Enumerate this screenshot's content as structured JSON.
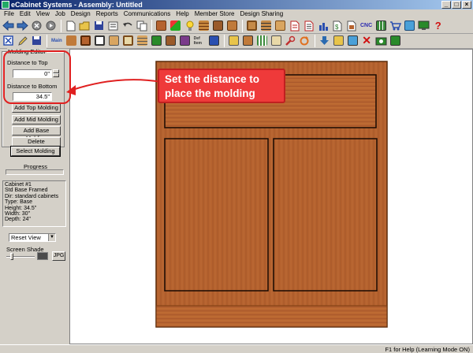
{
  "window": {
    "title": "eCabinet Systems - Assembly: Untitled"
  },
  "menu": [
    "File",
    "Edit",
    "View",
    "Job",
    "Design",
    "Reports",
    "Communications",
    "Help",
    "Member Store",
    "Design Sharing"
  ],
  "toolbar": {
    "cnc_label": "CNC",
    "main_label": "Main",
    "def_label": "Def Item"
  },
  "molding_editor": {
    "group_title": "Molding Editor",
    "distance_top_label": "Distance to Top",
    "distance_top_value": "0\"",
    "distance_bottom_label": "Distance to Bottom",
    "distance_bottom_value": "34.5\"",
    "buttons": [
      "Add Top Molding",
      "Add Mid Molding",
      "Add Base Molding",
      "Delete",
      "Select Molding"
    ]
  },
  "progress": {
    "label": "Progress",
    "value": 0
  },
  "cabinet_info": [
    "Cabinet #1",
    "Std Base Framed",
    "Dir: standard cabinets",
    "Type: Base",
    "Height: 34.5\"",
    "Width: 30\"",
    "Depth: 24\""
  ],
  "view": {
    "selected": "Reset View"
  },
  "screen_shade": {
    "label": "Screen Shade",
    "jpg_label": "JPG",
    "level": 0.15,
    "swatch_color": "#4b4b4b"
  },
  "callout": {
    "line1": "Set the distance to",
    "line2": "place the molding",
    "color": "#ef3a3a"
  },
  "status": {
    "text": "F1 for Help (Learning Mode ON)"
  },
  "colors": {
    "wood": "#b5622e",
    "wood_dark": "#8a4a22",
    "titlebar": "#0a246a"
  }
}
